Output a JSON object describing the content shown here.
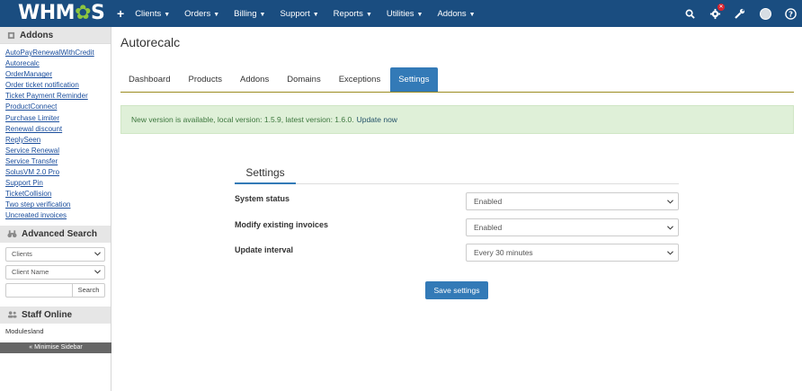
{
  "brand": {
    "logo_text_a": "WHM",
    "logo_text_b": "S",
    "accent": "#8dc63f",
    "navbar_bg": "#1a4d80"
  },
  "nav": {
    "items": [
      {
        "label": "Clients"
      },
      {
        "label": "Orders"
      },
      {
        "label": "Billing"
      },
      {
        "label": "Support"
      },
      {
        "label": "Reports"
      },
      {
        "label": "Utilities"
      },
      {
        "label": "Addons"
      }
    ],
    "icons": [
      "search-icon",
      "notifications-icon",
      "wrench-icon",
      "user-avatar-icon",
      "help-icon"
    ]
  },
  "sidebar": {
    "addons_title": "Addons",
    "addons": [
      "AutoPayRenewalWithCredit",
      "Autorecalc",
      "OrderManager",
      "Order ticket notification",
      "Ticket Payment Reminder",
      "ProductConnect",
      "Purchase Limiter",
      "Renewal discount",
      "ReplySeen",
      "Service Renewal",
      "Service Transfer",
      "SolusVM 2.0 Pro",
      "Support Pin",
      "TicketCollision",
      "Two step verification",
      "Uncreated invoices"
    ],
    "advanced_search_title": "Advanced Search",
    "search_type": "Clients",
    "search_field": "Client Name",
    "search_button": "Search",
    "staff_title": "Staff Online",
    "staff": "Modulesland",
    "minimise": "« Minimise Sidebar"
  },
  "main": {
    "title": "Autorecalc",
    "tabs": [
      {
        "label": "Dashboard"
      },
      {
        "label": "Products"
      },
      {
        "label": "Addons"
      },
      {
        "label": "Domains"
      },
      {
        "label": "Exceptions"
      },
      {
        "label": "Settings"
      }
    ],
    "alert_text": "New version is available, local version: 1.5.9, latest version: 1.6.0.",
    "alert_link": "Update now",
    "settings_heading": "Settings",
    "rows": [
      {
        "label": "System status",
        "value": "Enabled"
      },
      {
        "label": "Modify existing invoices",
        "value": "Enabled"
      },
      {
        "label": "Update interval",
        "value": "Every 30 minutes"
      }
    ],
    "save_button": "Save settings"
  }
}
